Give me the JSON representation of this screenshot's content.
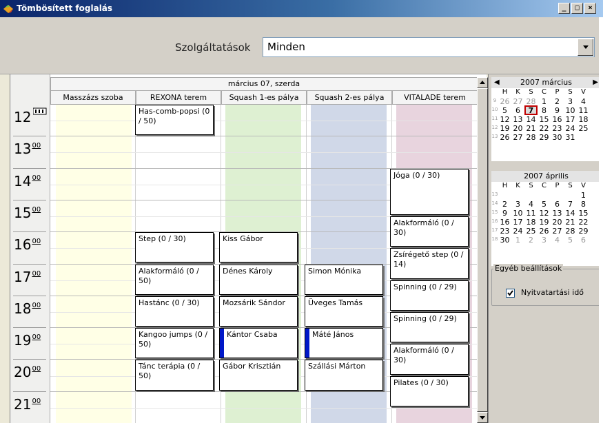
{
  "window": {
    "title": "Tömbösített foglalás",
    "btn_min": "_",
    "btn_max": "□",
    "btn_close": "×"
  },
  "services": {
    "label": "Szolgáltatások",
    "value": "Minden"
  },
  "schedule": {
    "date": "március 07, szerda",
    "columns": [
      "Masszázs szoba",
      "REXONA terem",
      "Squash 1-es pálya",
      "Squash 2-es pálya",
      "VITALADE terem"
    ],
    "column_colors": [
      "#ffffe6",
      "#ffffff",
      "#def0d2",
      "#d0d8e8",
      "#e8d4de"
    ],
    "hours": [
      "12",
      "13",
      "14",
      "15",
      "16",
      "17",
      "18",
      "19",
      "20",
      "21"
    ],
    "minutes": "00",
    "events": {
      "rexona": [
        "Has-comb-popsi (0 / 50)",
        "Step (0 / 30)",
        "Alakformáló (0 / 50)",
        "Hastánc (0 / 30)",
        "Kangoo jumps (0 / 50)",
        "Tánc terápia (0 / 50)"
      ],
      "squash1": [
        "Kiss Gábor",
        "Dénes Károly",
        "Mozsárik Sándor",
        "Kántor Csaba",
        "Gábor Krisztián"
      ],
      "squash2": [
        "Simon Mónika",
        "Üveges Tamás",
        "Máté János",
        "Szállási Márton"
      ],
      "vitalade": [
        "Jóga (0 / 30)",
        "Alakformáló (0 / 30)",
        "Zsírégető step (0 / 14)",
        "Spinning (0 / 29)",
        "Spinning (0 / 29)",
        "Alakformáló (0 / 30)",
        "Pilates (0 / 30)"
      ]
    }
  },
  "calendar": {
    "dow": [
      "H",
      "K",
      "S",
      "C",
      "P",
      "S",
      "V"
    ],
    "march": {
      "title": "2007 március",
      "weeks": [
        {
          "wn": "9",
          "days": [
            "26",
            "27",
            "28",
            "1",
            "2",
            "3",
            "4"
          ]
        },
        {
          "wn": "10",
          "days": [
            "5",
            "6",
            "7",
            "8",
            "9",
            "10",
            "11"
          ]
        },
        {
          "wn": "11",
          "days": [
            "12",
            "13",
            "14",
            "15",
            "16",
            "17",
            "18"
          ]
        },
        {
          "wn": "12",
          "days": [
            "19",
            "20",
            "21",
            "22",
            "23",
            "24",
            "25"
          ]
        },
        {
          "wn": "13",
          "days": [
            "26",
            "27",
            "28",
            "29",
            "30",
            "31",
            ""
          ]
        }
      ],
      "selected": "7"
    },
    "april": {
      "title": "2007 április",
      "weeks": [
        {
          "wn": "13",
          "days": [
            "",
            "",
            "",
            "",
            "",
            "",
            "1"
          ]
        },
        {
          "wn": "14",
          "days": [
            "2",
            "3",
            "4",
            "5",
            "6",
            "7",
            "8"
          ]
        },
        {
          "wn": "15",
          "days": [
            "9",
            "10",
            "11",
            "12",
            "13",
            "14",
            "15"
          ]
        },
        {
          "wn": "16",
          "days": [
            "16",
            "17",
            "18",
            "19",
            "20",
            "21",
            "22"
          ]
        },
        {
          "wn": "17",
          "days": [
            "23",
            "24",
            "25",
            "26",
            "27",
            "28",
            "29"
          ]
        },
        {
          "wn": "18",
          "days": [
            "30",
            "1",
            "2",
            "3",
            "4",
            "5",
            "6"
          ]
        }
      ]
    }
  },
  "settings": {
    "legend": "Egyéb beállítások",
    "checkbox_label": "Nyitvatartási idő",
    "checked": true
  }
}
